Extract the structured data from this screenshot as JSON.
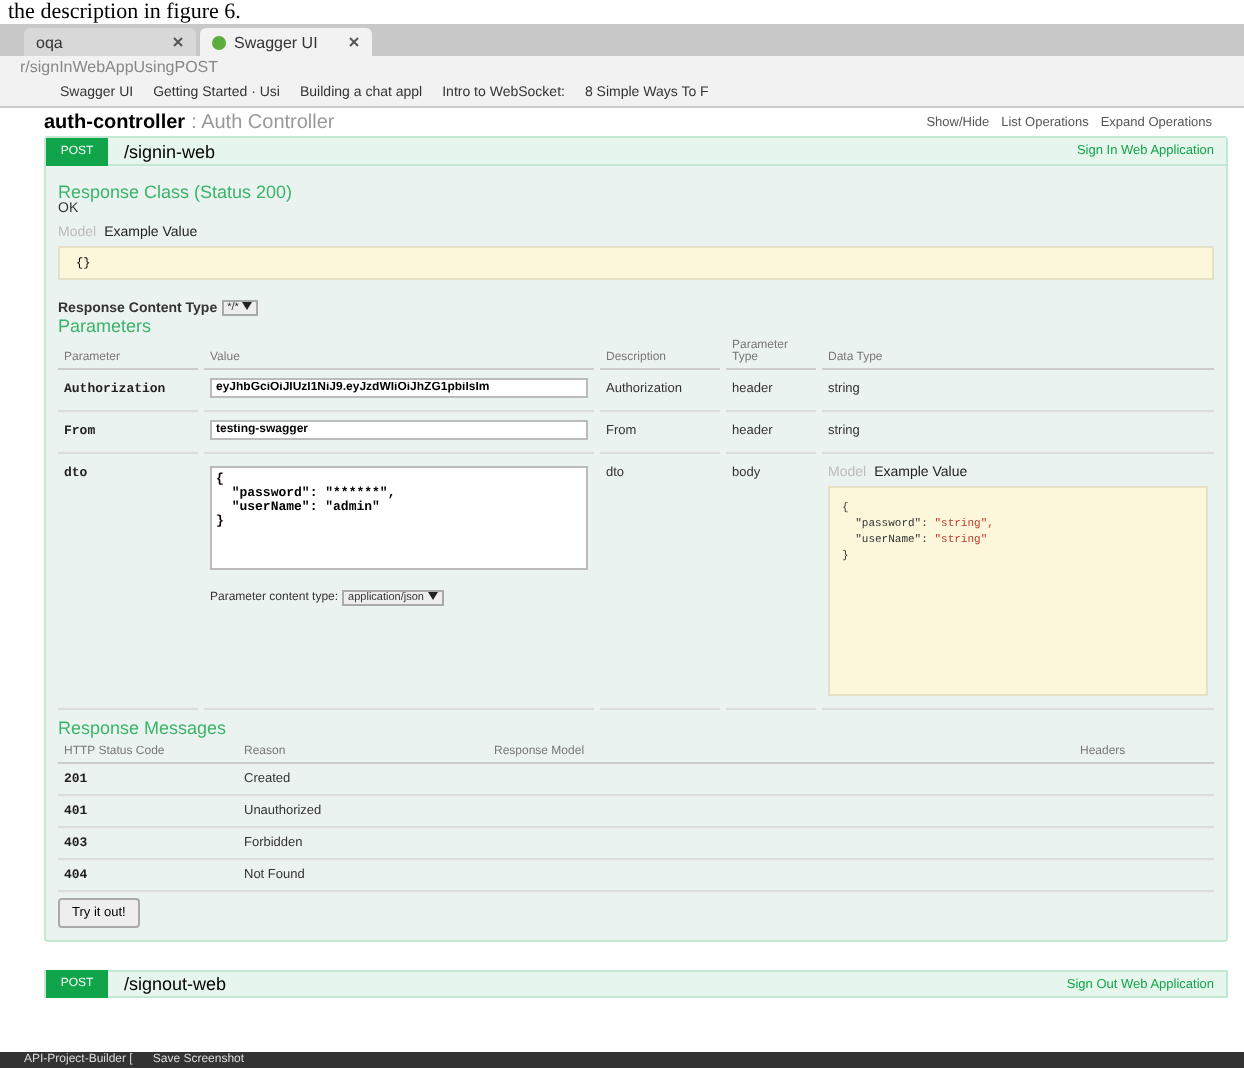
{
  "caption": "the description in figure 6.",
  "browser": {
    "tabs": [
      {
        "label": "oqa",
        "selected": false
      },
      {
        "label": "Swagger UI",
        "selected": true
      }
    ],
    "url": "r/signInWebAppUsingPOST",
    "bookmarks": [
      "Swagger UI",
      "Getting Started · Usi",
      "Building a chat appl",
      "Intro to WebSocket:",
      "8 Simple Ways To F"
    ]
  },
  "controller": {
    "name": "auth-controller",
    "description": ": Auth Controller",
    "links": [
      "Show/Hide",
      "List Operations",
      "Expand Operations"
    ]
  },
  "operation": {
    "method": "POST",
    "path": "/signin-web",
    "summary": "Sign In Web Application",
    "response_class": {
      "title": "Response Class (Status 200)",
      "status": "OK",
      "tabs": [
        {
          "label": "Model",
          "selected": false
        },
        {
          "label": "Example Value",
          "selected": true
        }
      ],
      "example": "{}"
    },
    "response_content_type": {
      "label": "Response Content Type",
      "value": "*/*"
    },
    "parameters_title": "Parameters",
    "parameter_columns": [
      "Parameter",
      "Value",
      "Description",
      "Parameter Type",
      "Data Type"
    ],
    "parameters": [
      {
        "kind": "input",
        "name": "Authorization",
        "value": "eyJhbGciOiJIUzI1NiJ9.eyJzdWIiOiJhZG1pbiIsIm",
        "description": "Authorization",
        "type": "header",
        "data_type": "string"
      },
      {
        "kind": "input",
        "name": "From",
        "value": "testing-swagger",
        "description": "From",
        "type": "header",
        "data_type": "string"
      },
      {
        "kind": "body",
        "name": "dto",
        "value": "{\n  \"password\": \"******\",\n  \"userName\": \"admin\"\n}",
        "description": "dto",
        "type": "body",
        "content_type_label": "Parameter content type:",
        "content_type": "application/json",
        "model_tabs": [
          {
            "label": "Model",
            "selected": false
          },
          {
            "label": "Example Value",
            "selected": true
          }
        ],
        "example_lines": [
          {
            "key": "{"
          },
          {
            "key": "  \"password\": ",
            "value": "\"string\","
          },
          {
            "key": "  \"userName\": ",
            "value": "\"string\""
          },
          {
            "key": "}"
          }
        ]
      }
    ],
    "messages_title": "Response Messages",
    "message_columns": [
      "HTTP Status Code",
      "Reason",
      "Response Model",
      "Headers"
    ],
    "messages": [
      {
        "code": "201",
        "reason": "Created"
      },
      {
        "code": "401",
        "reason": "Unauthorized"
      },
      {
        "code": "403",
        "reason": "Forbidden"
      },
      {
        "code": "404",
        "reason": "Not Found"
      }
    ],
    "try_button": "Try it out!"
  },
  "next_operation": {
    "method": "POST",
    "path": "/signout-web",
    "summary": "Sign Out Web Application"
  },
  "taskbar": [
    "API-Project-Builder [",
    "Save Screenshot"
  ]
}
